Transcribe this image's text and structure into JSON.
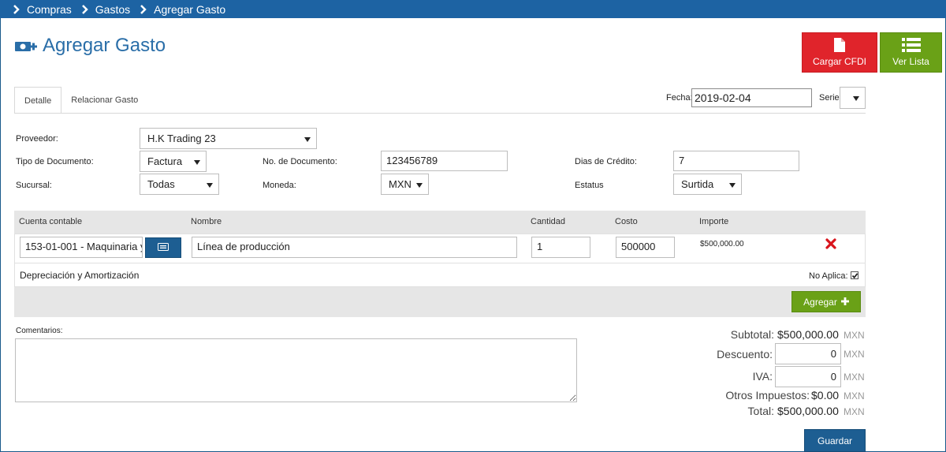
{
  "breadcrumb": {
    "items": [
      "Compras",
      "Gastos",
      "Agregar Gasto"
    ]
  },
  "page": {
    "title": "Agregar Gasto"
  },
  "actions": {
    "cfdi_label": "Cargar CFDI",
    "list_label": "Ver Lista"
  },
  "tabs": [
    {
      "label": "Detalle"
    },
    {
      "label": "Relacionar Gasto"
    }
  ],
  "header_fields": {
    "fecha_label": "Fecha:",
    "fecha_value": "2019-02-04",
    "serie_label": "Serie",
    "serie_value": ""
  },
  "form": {
    "proveedor_label": "Proveedor:",
    "proveedor_value": "H.K Trading 23",
    "tipo_label": "Tipo de Documento:",
    "tipo_value": "Factura",
    "no_doc_label": "No. de Documento:",
    "no_doc_value": "123456789",
    "dias_label": "Dias de Crédito:",
    "dias_value": "7",
    "sucursal_label": "Sucursal:",
    "sucursal_value": "Todas",
    "moneda_label": "Moneda:",
    "moneda_value": "MXN",
    "estatus_label": "Estatus",
    "estatus_value": "Surtida"
  },
  "table": {
    "headers": {
      "cuenta": "Cuenta contable",
      "nombre": "Nombre",
      "cantidad": "Cantidad",
      "costo": "Costo",
      "importe": "Importe"
    },
    "row": {
      "cuenta": "153-01-001 - Maquinaria y",
      "nombre": "Línea de producción",
      "cantidad": "1",
      "costo": "500000",
      "importe": "$500,000.00"
    },
    "sub": {
      "label": "Depreciación y Amortización",
      "no_aplica_label": "No Aplica:",
      "no_aplica_checked": true
    },
    "add_label": "Agregar"
  },
  "comments": {
    "label": "Comentarios:",
    "value": ""
  },
  "totals": {
    "subtotal_label": "Subtotal:",
    "subtotal_value": "$500,000.00",
    "descuento_label": "Descuento:",
    "descuento_value": "0",
    "iva_label": "IVA:",
    "iva_value": "0",
    "otros_label": "Otros Impuestos:",
    "otros_value": "$0.00",
    "total_label": "Total:",
    "total_value": "$500,000.00",
    "currency": "MXN"
  },
  "save_label": "Guardar",
  "colors": {
    "brand_blue": "#1d63a3",
    "danger": "#e0242b",
    "success": "#6aa117"
  }
}
